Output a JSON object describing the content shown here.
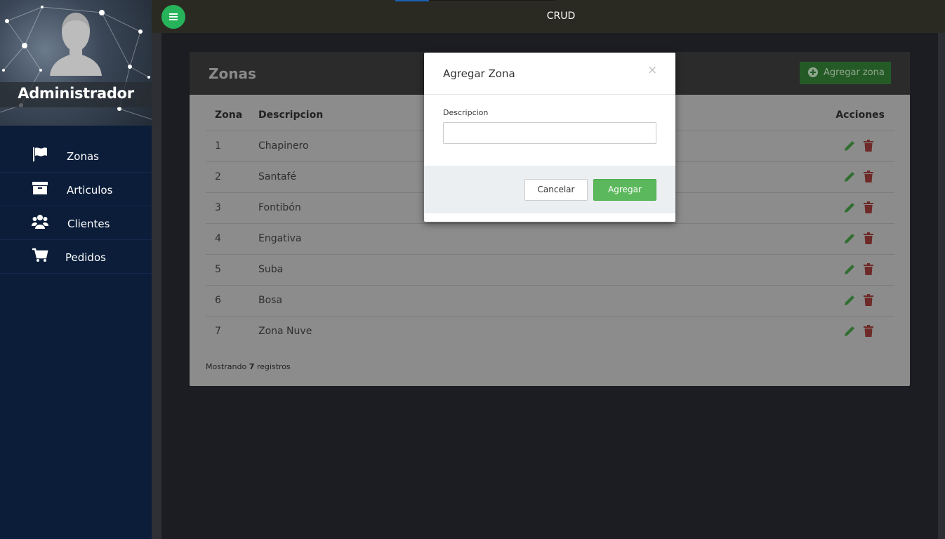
{
  "sidebar": {
    "admin_name": "Administrador",
    "items": [
      {
        "label": "Zonas",
        "icon": "flag-icon"
      },
      {
        "label": "Articulos",
        "icon": "archive-icon"
      },
      {
        "label": "Clientes",
        "icon": "users-icon"
      },
      {
        "label": "Pedidos",
        "icon": "cart-icon"
      }
    ]
  },
  "topbar": {
    "title": "CRUD",
    "menu_icon": "menu-icon"
  },
  "card": {
    "title": "Zonas",
    "add_button": "Agregar zona",
    "columns": [
      "Zona",
      "Descripcion",
      "Acciones"
    ],
    "rows": [
      {
        "zona": "1",
        "descripcion": "Chapinero"
      },
      {
        "zona": "2",
        "descripcion": "Santafé"
      },
      {
        "zona": "3",
        "descripcion": "Fontibón"
      },
      {
        "zona": "4",
        "descripcion": "Engativa"
      },
      {
        "zona": "5",
        "descripcion": "Suba"
      },
      {
        "zona": "6",
        "descripcion": "Bosa"
      },
      {
        "zona": "7",
        "descripcion": "Zona Nuve"
      }
    ],
    "footer_prefix": "Mostrando",
    "footer_count": "7",
    "footer_suffix": "registros"
  },
  "modal": {
    "title": "Agregar Zona",
    "close": "×",
    "field_label": "Descripcion",
    "field_value": "",
    "cancel": "Cancelar",
    "submit": "Agregar"
  },
  "colors": {
    "accent_green": "#5cb85c",
    "menu_green": "#27b35a",
    "sidebar_bg": "#0b1d39",
    "edit_icon": "#4cae4c",
    "delete_icon": "#d9534f"
  }
}
